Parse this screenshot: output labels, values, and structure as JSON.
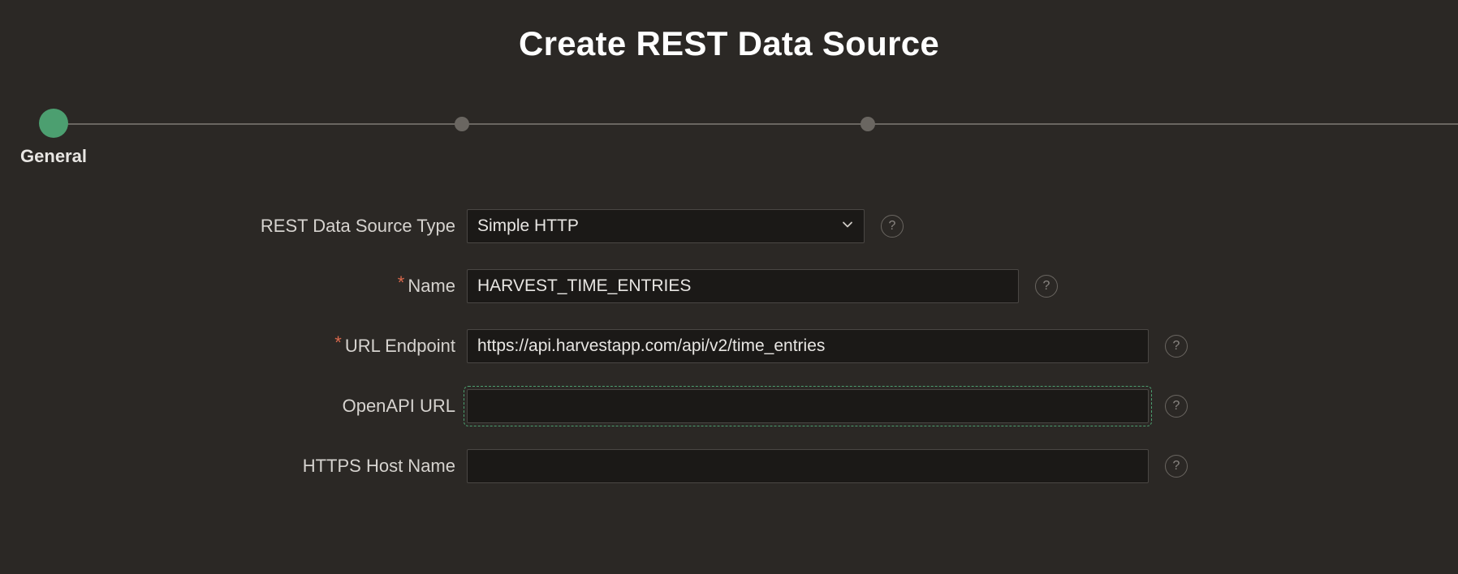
{
  "title": "Create REST Data Source",
  "wizard": {
    "steps": [
      {
        "label": "General",
        "active": true
      }
    ]
  },
  "form": {
    "type": {
      "label": "REST Data Source Type",
      "value": "Simple HTTP"
    },
    "name": {
      "label": "Name",
      "required": true,
      "value": "HARVEST_TIME_ENTRIES"
    },
    "url_endpoint": {
      "label": "URL Endpoint",
      "required": true,
      "value": "https://api.harvestapp.com/api/v2/time_entries"
    },
    "openapi_url": {
      "label": "OpenAPI URL",
      "value": ""
    },
    "https_host_name": {
      "label": "HTTPS Host Name",
      "value": ""
    }
  },
  "glyphs": {
    "required": "*",
    "help": "?"
  }
}
